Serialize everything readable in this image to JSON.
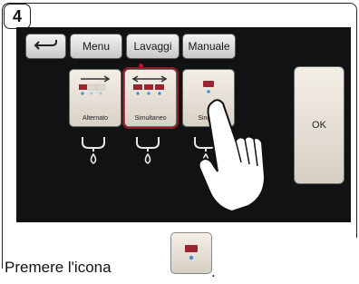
{
  "step": {
    "number": "4"
  },
  "screen": {
    "back_icon": "back-arrow-icon",
    "menu_label": "Menu",
    "lavaggi_label": "Lavaggi",
    "manuale_label": "Manuale",
    "ok_label": "OK",
    "tiles": [
      {
        "label": "Alternato",
        "icon": "alternate-dispense-icon"
      },
      {
        "label": "Simultaneo",
        "icon": "simultaneous-dispense-icon"
      },
      {
        "label": "Singolo",
        "icon": "single-dispense-icon"
      }
    ]
  },
  "caption": {
    "text": "Premere l'icona",
    "end": "."
  },
  "colors": {
    "screen_bg": "#111214",
    "accent": "#8e1b25",
    "drop": "#3a8fd6",
    "bar": "#9a2430"
  }
}
